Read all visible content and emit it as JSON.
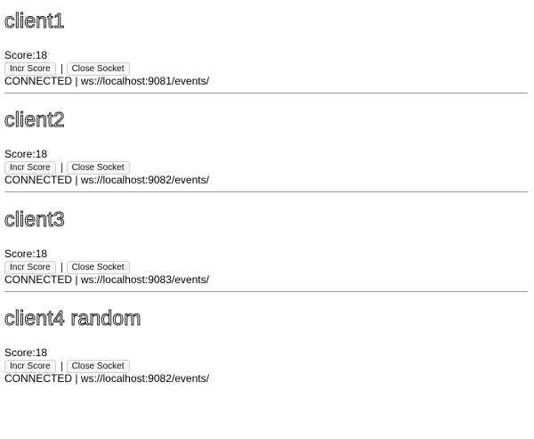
{
  "clients": [
    {
      "title": "client1",
      "score_label": "Score:",
      "score": "18",
      "incr_label": "Incr Score",
      "close_label": "Close Socket",
      "status": "CONNECTED",
      "separator": "|",
      "url": "ws://localhost:9081/events/"
    },
    {
      "title": "client2",
      "score_label": "Score:",
      "score": "18",
      "incr_label": "Incr Score",
      "close_label": "Close Socket",
      "status": "CONNECTED",
      "separator": "|",
      "url": "ws://localhost:9082/events/"
    },
    {
      "title": "client3",
      "score_label": "Score:",
      "score": "18",
      "incr_label": "Incr Score",
      "close_label": "Close Socket",
      "status": "CONNECTED",
      "separator": "|",
      "url": "ws://localhost:9083/events/"
    },
    {
      "title": "client4 random",
      "score_label": "Score:",
      "score": "18",
      "incr_label": "Incr Score",
      "close_label": "Close Socket",
      "status": "CONNECTED",
      "separator": "|",
      "url": "ws://localhost:9082/events/"
    }
  ]
}
